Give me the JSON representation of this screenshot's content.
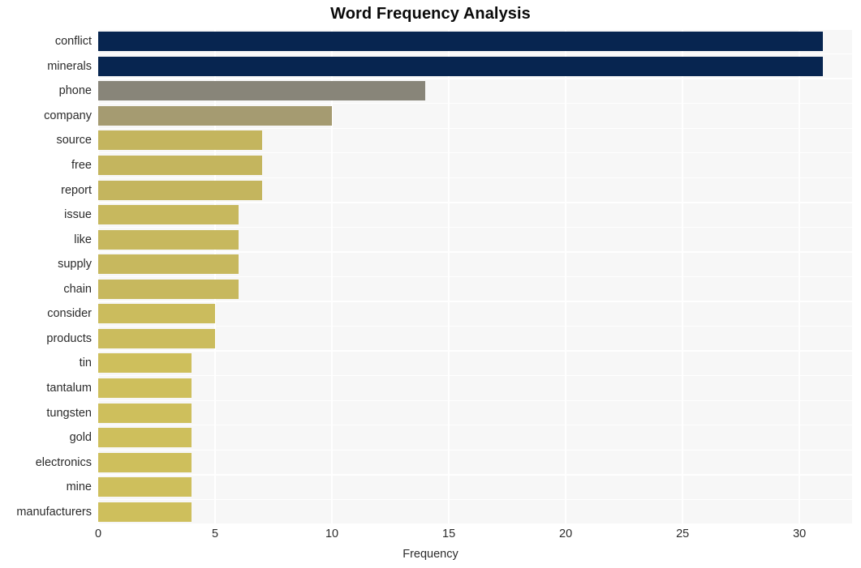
{
  "chart_data": {
    "type": "bar",
    "orientation": "horizontal",
    "title": "Word Frequency Analysis",
    "xlabel": "Frequency",
    "ylabel": "",
    "xlim": [
      0,
      32.25
    ],
    "xticks": [
      0,
      5,
      10,
      15,
      20,
      25,
      30
    ],
    "xtick_labels": [
      "0",
      "5",
      "10",
      "15",
      "20",
      "25",
      "30"
    ],
    "grid": true,
    "legend": null,
    "categories": [
      "conflict",
      "minerals",
      "phone",
      "company",
      "source",
      "free",
      "report",
      "issue",
      "like",
      "supply",
      "chain",
      "consider",
      "products",
      "tin",
      "tantalum",
      "tungsten",
      "gold",
      "electronics",
      "mine",
      "manufacturers"
    ],
    "values": [
      31,
      31,
      14,
      10,
      7,
      7,
      7,
      6,
      6,
      6,
      6,
      5,
      5,
      4,
      4,
      4,
      4,
      4,
      4,
      4
    ],
    "bar_colors": [
      "#072550",
      "#072550",
      "#888579",
      "#a59b71",
      "#c4b55e",
      "#c4b55e",
      "#c4b55e",
      "#c7b85e",
      "#c7b85e",
      "#c7b85e",
      "#c7b85e",
      "#cbbc5d",
      "#cbbc5d",
      "#cebf5c",
      "#cebf5c",
      "#cebf5c",
      "#cebf5c",
      "#cebf5c",
      "#cebf5c",
      "#cebf5c"
    ],
    "plot_background": "#f7f7f7",
    "grid_color": "#ffffff",
    "figure_background": "#ffffff",
    "text_color": "#2b2b2b",
    "title_color": "#0a0a0a"
  }
}
